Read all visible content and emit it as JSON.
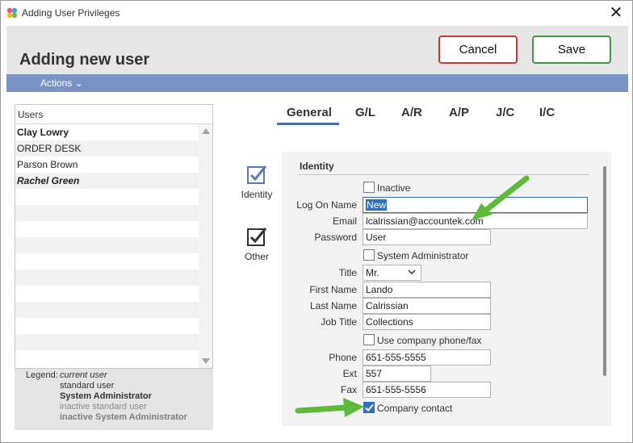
{
  "window": {
    "title": "Adding User Privileges"
  },
  "header": {
    "title": "Adding new user",
    "cancel_label": "Cancel",
    "save_label": "Save"
  },
  "actionbar": {
    "actions_label": "Actions ⌄"
  },
  "users_panel": {
    "header": "Users",
    "rows": [
      "Clay Lowry",
      "ORDER DESK",
      "Parson Brown",
      "Rachel Green"
    ],
    "legend_label": "Legend:",
    "legend_items": [
      "current user",
      "standard user",
      "System Administrator",
      "inactive standard user",
      "inactive System Administrator"
    ]
  },
  "tabs": [
    "General",
    "G/L",
    "A/R",
    "A/P",
    "J/C",
    "I/C"
  ],
  "side_nav": {
    "identity_label": "Identity",
    "other_label": "Other"
  },
  "form": {
    "section_title": "Identity",
    "inactive_label": "Inactive",
    "logon_label": "Log On Name",
    "logon_value": "New",
    "email_label": "Email",
    "email_value": "lcalrissian@accountek.com",
    "password_label": "Password",
    "password_value": "User",
    "sysadmin_label": "System Administrator",
    "title_label": "Title",
    "title_value": "Mr.",
    "firstname_label": "First Name",
    "firstname_value": "Lando",
    "lastname_label": "Last Name",
    "lastname_value": "Calrissian",
    "jobtitle_label": "Job Title",
    "jobtitle_value": "Collections",
    "use_company_phone_label": "Use company phone/fax",
    "phone_label": "Phone",
    "phone_value": "651-555-5555",
    "ext_label": "Ext",
    "ext_value": "557",
    "fax_label": "Fax",
    "fax_value": "651-555-5556",
    "company_contact_label": "Company contact",
    "company_contact_checked": true
  },
  "colors": {
    "accent": "#7b93c4",
    "cancel_border": "#c23b3b",
    "save_border": "#3f9a3f",
    "arrow": "#5dba3a"
  }
}
